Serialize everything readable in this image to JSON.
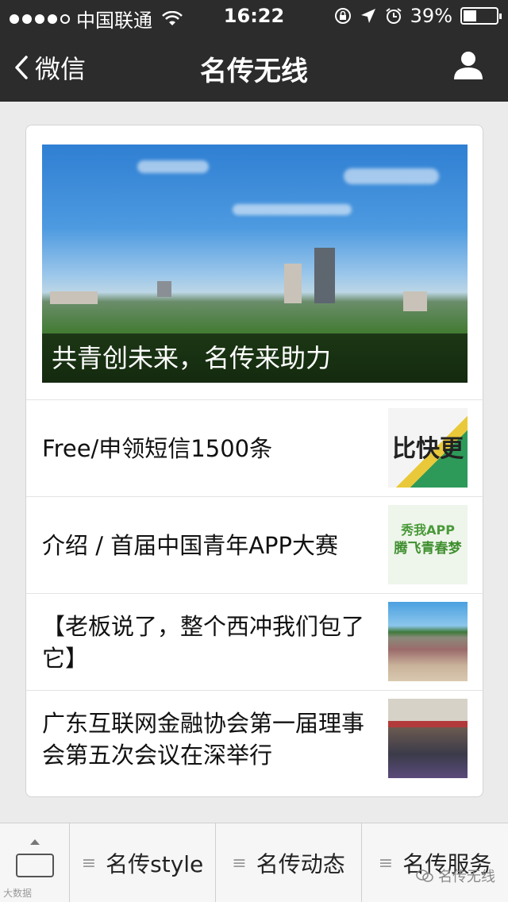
{
  "status_bar": {
    "carrier": "中国联通",
    "time": "16:22",
    "battery": "39%",
    "battery_level": 0.39
  },
  "nav": {
    "back_label": "微信",
    "title": "名传无线"
  },
  "hero": {
    "caption": "共青创未来，名传来助力"
  },
  "articles": [
    {
      "title": "Free/申领短信1500条",
      "thumb_text": "比快更"
    },
    {
      "title": "介绍 / 首届中国青年APP大赛",
      "thumb_text_1": "秀我APP",
      "thumb_text_2": "腾飞青春梦"
    },
    {
      "title": "【老板说了，整个西冲我们包了它】"
    },
    {
      "title": "广东互联网金融协会第一届理事会第五次会议在深举行"
    }
  ],
  "menu": [
    {
      "label": "名传style",
      "icon": "menu-lines-icon"
    },
    {
      "label": "名传动态",
      "icon": "menu-lines-icon"
    },
    {
      "label": "名传服务",
      "icon": "menu-lines-icon"
    }
  ],
  "watermark": {
    "left": "大数据",
    "right": "名传无线"
  }
}
